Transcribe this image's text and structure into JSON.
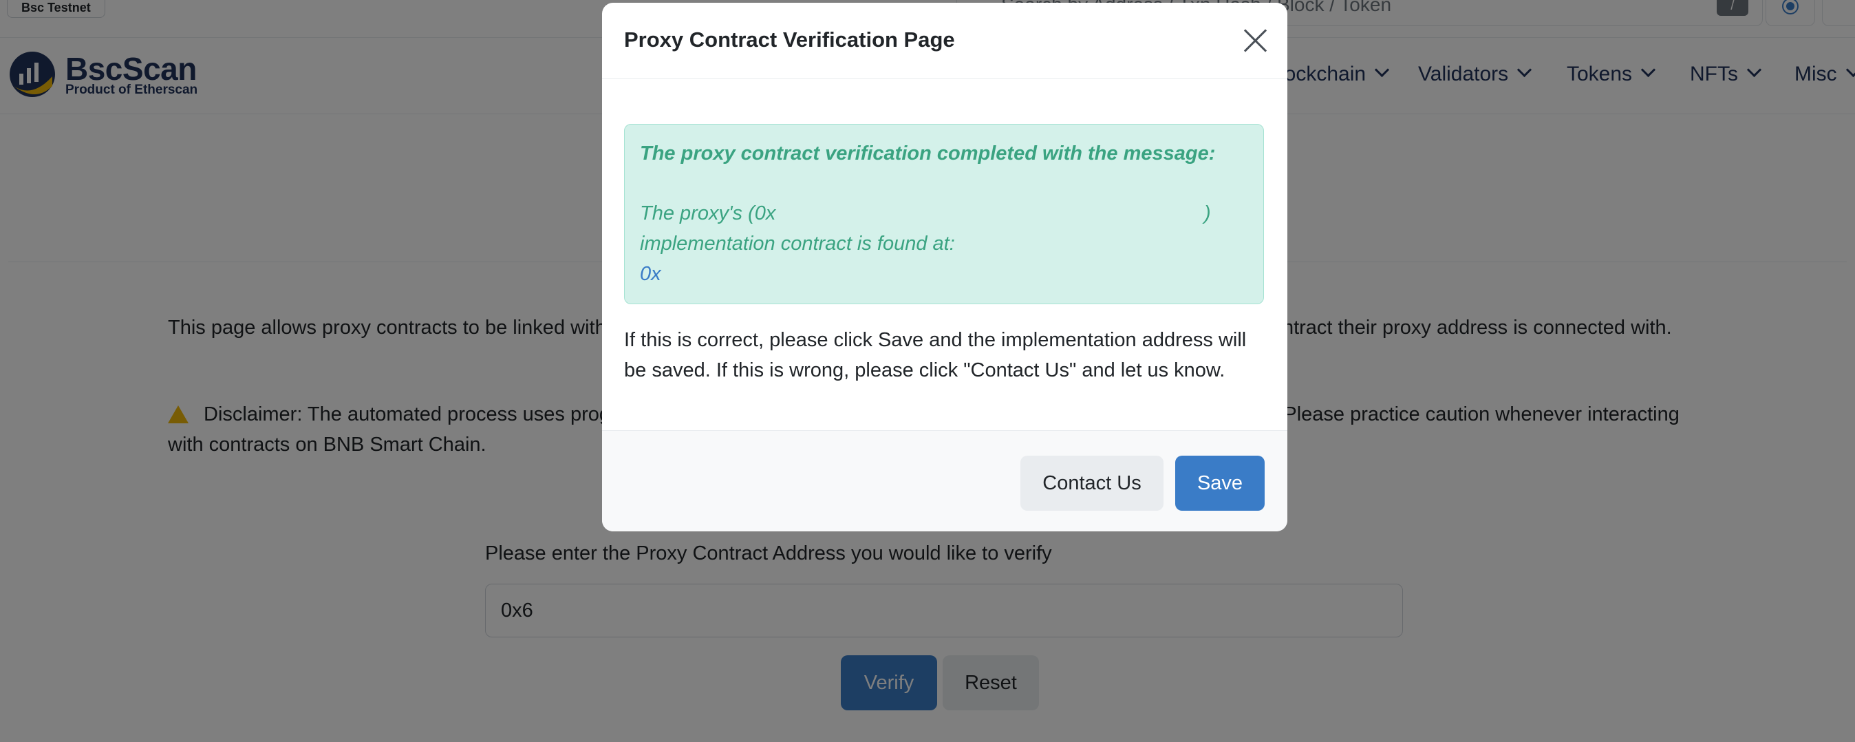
{
  "header": {
    "network_badge": "Bsc Testnet",
    "search_placeholder": "Search by Address / Txn Hash / Block / Token",
    "search_shortcut": "/"
  },
  "nav": {
    "brand": "BscScan",
    "brand_sub": "Product of Etherscan",
    "items": [
      {
        "label": "Blockchain"
      },
      {
        "label": "Validators"
      },
      {
        "label": "Tokens"
      },
      {
        "label": "NFTs"
      },
      {
        "label": "Misc"
      }
    ]
  },
  "page": {
    "intro": "This page allows proxy contracts to be linked with their implementation contracts, allowing users to interact and know which contract their proxy address is connected with.",
    "disclaimer": "Disclaimer: The automated process uses programmatic checks to determine if the contract should act as a proxy contract. Please practice caution whenever interacting with contracts on BNB Smart Chain.",
    "form_label": "Please enter the Proxy Contract Address you would like to verify",
    "input_value": "0x6",
    "verify_label": "Verify",
    "reset_label": "Reset"
  },
  "modal": {
    "title": "Proxy Contract Verification Page",
    "alert_heading": "The proxy contract verification completed with the message:",
    "alert_line1_start": "The proxy's (0x",
    "alert_line1_end": ")",
    "alert_line2": "implementation contract is found at:",
    "alert_address": "0x",
    "body_text": "If this is correct, please click Save and the implementation address will be saved. If this is wrong, please click \"Contact Us\" and let us know.",
    "contact_label": "Contact Us",
    "save_label": "Save"
  },
  "colors": {
    "primary": "#3a7cc7",
    "brand_navy": "#21325b",
    "alert_bg": "#d4f1ea",
    "alert_text": "#3aa381",
    "warning": "#f0b90b"
  }
}
